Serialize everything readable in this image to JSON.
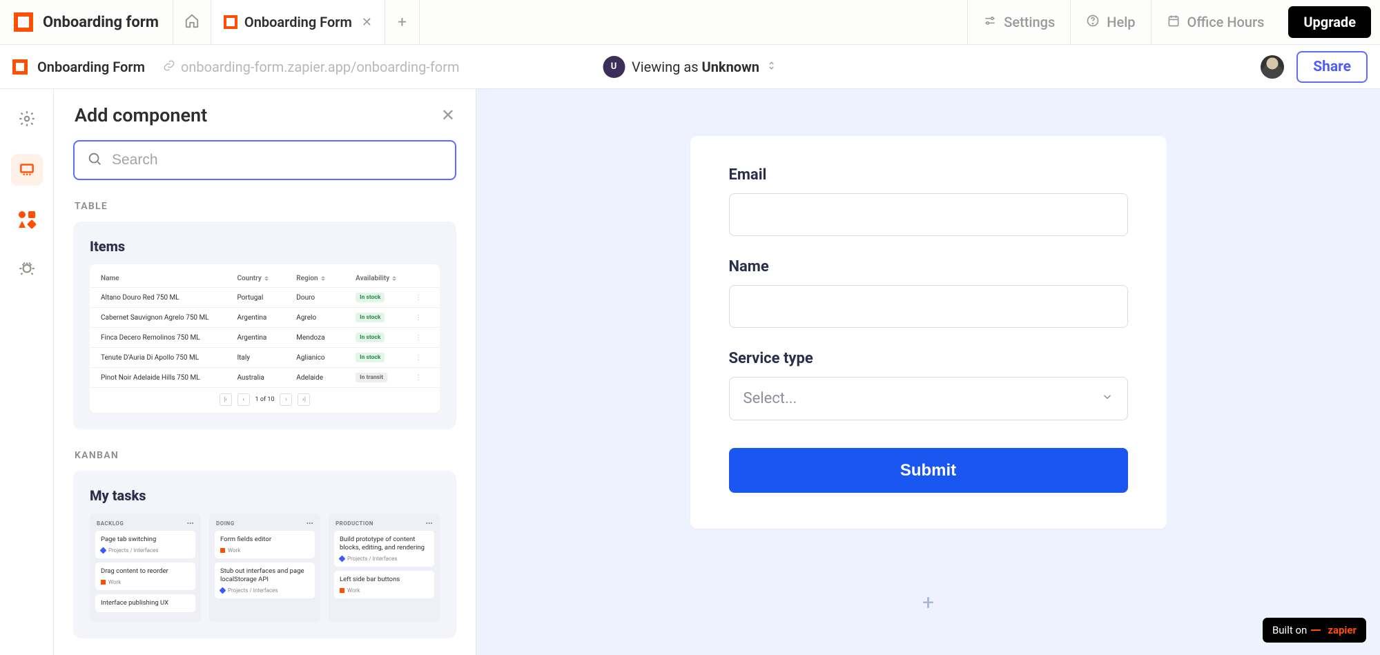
{
  "topbar": {
    "app_title": "Onboarding form",
    "tab_title": "Onboarding Form",
    "new_tab": "+",
    "actions": {
      "settings": "Settings",
      "help": "Help",
      "office_hours": "Office Hours",
      "upgrade": "Upgrade"
    }
  },
  "secondbar": {
    "page_title": "Onboarding Form",
    "url": "onboarding-form.zapier.app/onboarding-form",
    "viewer_badge": "U",
    "viewer_prefix": "Viewing as ",
    "viewer_name": "Unknown",
    "share": "Share"
  },
  "sidepanel": {
    "title": "Add component",
    "search_placeholder": "Search",
    "categories": {
      "table": "TABLE",
      "kanban": "KANBAN"
    },
    "table_card": {
      "title": "Items",
      "columns": [
        "Name",
        "Country",
        "Region",
        "Availability"
      ],
      "rows": [
        {
          "name": "Altano Douro Red 750 ML",
          "country": "Portugal",
          "region": "Douro",
          "avail": "In stock",
          "avail_style": "green"
        },
        {
          "name": "Cabernet Sauvignon Agrelo 750 ML",
          "country": "Argentina",
          "region": "Agrelo",
          "avail": "In stock",
          "avail_style": "green"
        },
        {
          "name": "Finca Decero Remolinos 750 ML",
          "country": "Argentina",
          "region": "Mendoza",
          "avail": "In stock",
          "avail_style": "green"
        },
        {
          "name": "Tenute D'Auria Di Apollo 750 ML",
          "country": "Italy",
          "region": "Aglianico",
          "avail": "In stock",
          "avail_style": "green"
        },
        {
          "name": "Pinot Noir Adelaide Hills 750 ML",
          "country": "Australia",
          "region": "Adelaide",
          "avail": "In transit",
          "avail_style": "gray"
        }
      ],
      "pager": "1 of 10"
    },
    "kanban_card": {
      "title": "My tasks",
      "columns": [
        {
          "name": "BACKLOG",
          "cards": [
            {
              "t": "Page tab switching",
              "m": "Projects / Interfaces",
              "c": "blue"
            },
            {
              "t": "Drag content to reorder",
              "m": "Work",
              "c": "orange"
            },
            {
              "t": "Interface publishing UX",
              "m": "",
              "c": ""
            }
          ]
        },
        {
          "name": "DOING",
          "cards": [
            {
              "t": "Form fields editor",
              "m": "Work",
              "c": "orange"
            },
            {
              "t": "Stub out interfaces and page localStorage API",
              "m": "Projects / Interfaces",
              "c": "blue"
            }
          ]
        },
        {
          "name": "PRODUCTION",
          "cards": [
            {
              "t": "Build prototype of content blocks, editing, and rendering",
              "m": "Projects / Interfaces",
              "c": "blue"
            },
            {
              "t": "Left side bar buttons",
              "m": "Work",
              "c": "orange"
            },
            {
              "t": "",
              "m": "",
              "c": ""
            }
          ]
        }
      ]
    }
  },
  "form": {
    "fields": {
      "email": "Email",
      "name": "Name",
      "service_type": "Service type",
      "select_placeholder": "Select..."
    },
    "submit": "Submit"
  },
  "built_on": {
    "prefix": "Built on ",
    "brand": "zapier"
  }
}
